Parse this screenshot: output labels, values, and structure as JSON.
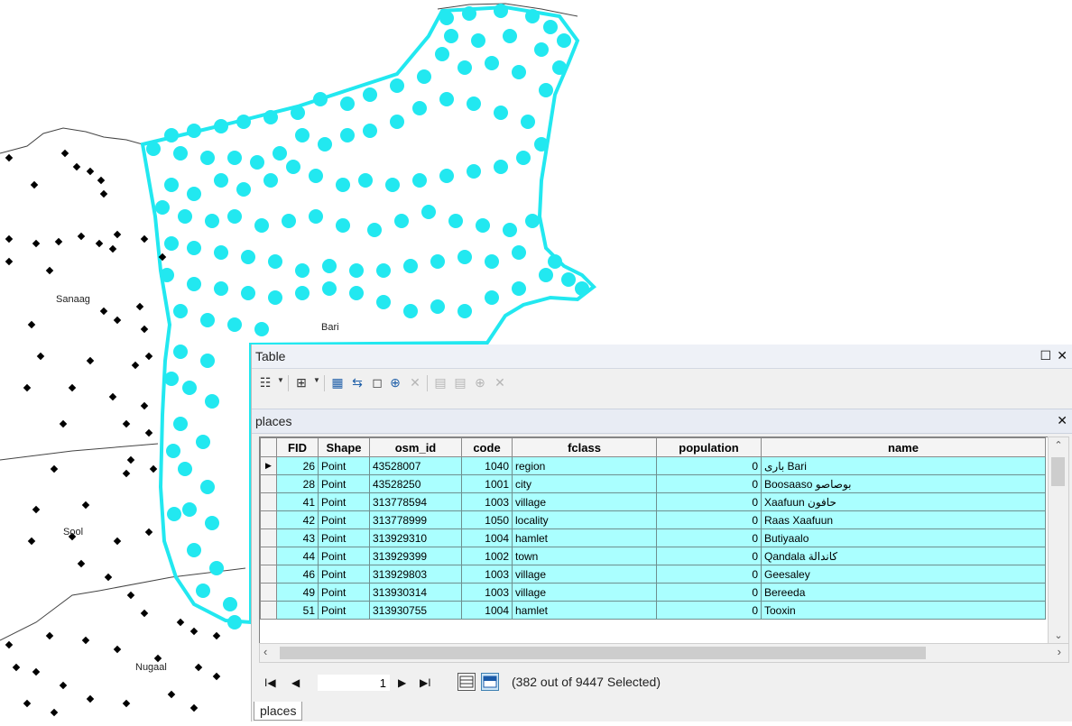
{
  "map": {
    "labels": [
      "Sanaag",
      "Bari",
      "Sool",
      "Nugaal"
    ]
  },
  "table_window": {
    "title": "Table",
    "maximize_icon": "maximize-icon",
    "close_icon": "close-icon",
    "toolbar": {
      "buttons": [
        "table-options-icon",
        "related-tables-icon",
        "select-by-attributes-icon",
        "switch-selection-icon",
        "clear-selection-icon",
        "zoom-to-selected-icon",
        "delete-selected-icon",
        "copy-icon",
        "paste-icon",
        "add-field-icon",
        "delete-icon"
      ]
    },
    "tab": {
      "name": "places",
      "close_icon": "close-icon"
    },
    "columns": [
      "FID",
      "Shape",
      "osm_id",
      "code",
      "fclass",
      "population",
      "name"
    ],
    "rows": [
      {
        "fid": "26",
        "shape": "Point",
        "osm_id": "43528007",
        "code": "1040",
        "fclass": "region",
        "population": "0",
        "name": "بارى Bari"
      },
      {
        "fid": "28",
        "shape": "Point",
        "osm_id": "43528250",
        "code": "1001",
        "fclass": "city",
        "population": "0",
        "name": "Boosaaso بوصاصو"
      },
      {
        "fid": "41",
        "shape": "Point",
        "osm_id": "313778594",
        "code": "1003",
        "fclass": "village",
        "population": "0",
        "name": "Xaafuun حافون"
      },
      {
        "fid": "42",
        "shape": "Point",
        "osm_id": "313778999",
        "code": "1050",
        "fclass": "locality",
        "population": "0",
        "name": "Raas Xaafuun"
      },
      {
        "fid": "43",
        "shape": "Point",
        "osm_id": "313929310",
        "code": "1004",
        "fclass": "hamlet",
        "population": "0",
        "name": "Butiyaalo"
      },
      {
        "fid": "44",
        "shape": "Point",
        "osm_id": "313929399",
        "code": "1002",
        "fclass": "town",
        "population": "0",
        "name": "Qandala كاندالة"
      },
      {
        "fid": "46",
        "shape": "Point",
        "osm_id": "313929803",
        "code": "1003",
        "fclass": "village",
        "population": "0",
        "name": "Geesaley"
      },
      {
        "fid": "49",
        "shape": "Point",
        "osm_id": "313930314",
        "code": "1003",
        "fclass": "village",
        "population": "0",
        "name": "Bereeda"
      },
      {
        "fid": "51",
        "shape": "Point",
        "osm_id": "313930755",
        "code": "1004",
        "fclass": "hamlet",
        "population": "0",
        "name": "Tooxin"
      }
    ],
    "navigation": {
      "current_record": "1",
      "status": "(382 out of 9447 Selected)"
    },
    "bottom_tab": "places"
  },
  "colors": {
    "selection": "#00ffff",
    "row_highlight": "#aaffff",
    "arrow": "#e8141a"
  }
}
